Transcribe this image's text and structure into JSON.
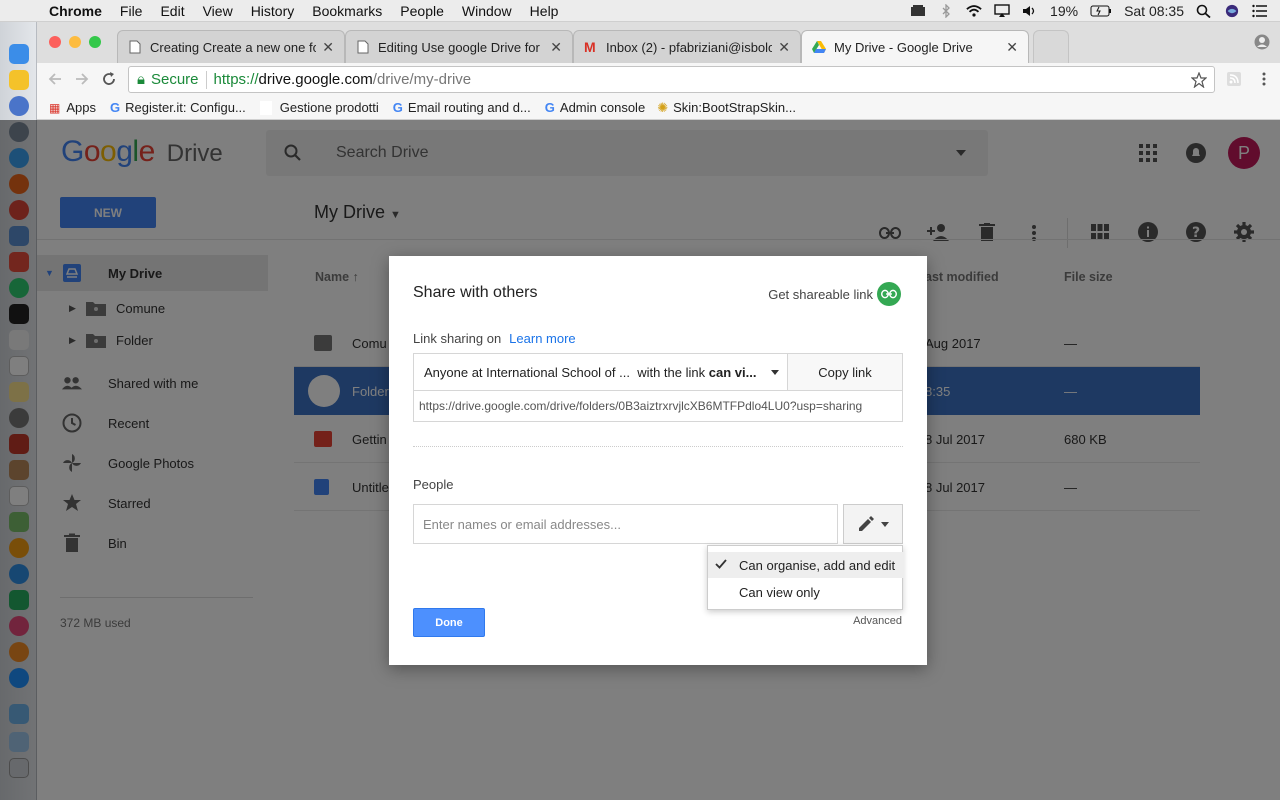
{
  "menubar": {
    "app": "Chrome",
    "items": [
      "File",
      "Edit",
      "View",
      "History",
      "Bookmarks",
      "People",
      "Window",
      "Help"
    ],
    "battery": "19%",
    "clock": "Sat 08:35"
  },
  "tabs": [
    {
      "title": "Creating Create a new one fold"
    },
    {
      "title": "Editing Use google Drive for br"
    },
    {
      "title": "Inbox (2) - pfabriziani@isbolog"
    },
    {
      "title": "My Drive - Google Drive"
    }
  ],
  "omnibox": {
    "secure": "Secure",
    "scheme": "https://",
    "host": "drive.google.com",
    "path": "/drive/my-drive"
  },
  "bookmarks": [
    "Apps",
    "Register.it: Configu...",
    "Gestione prodotti",
    "Email routing and d...",
    "Admin console",
    "Skin:BootStrapSkin..."
  ],
  "drive": {
    "logo_google": "Google",
    "logo_drive": "Drive",
    "search_placeholder": "Search Drive",
    "new_button": "NEW",
    "breadcrumb": "My Drive",
    "avatar_letter": "P",
    "nav": {
      "my_drive": "My Drive",
      "folder_comune": "Comune",
      "folder_folder": "Folder",
      "shared": "Shared with me",
      "recent": "Recent",
      "photos": "Google Photos",
      "starred": "Starred",
      "bin": "Bin"
    },
    "storage": "372 MB used",
    "columns": {
      "name": "Name",
      "last_modified": "ast modified",
      "file_size": "File size"
    },
    "rows": [
      {
        "name": "Comu",
        "modified": "Aug 2017",
        "size": "—"
      },
      {
        "name": "Folder",
        "modified": "8:35",
        "size": "—"
      },
      {
        "name": "Gettin",
        "modified": "8 Jul 2017",
        "size": "680 KB"
      },
      {
        "name": "Untitle",
        "modified": "8 Jul 2017",
        "size": "—"
      }
    ]
  },
  "dialog": {
    "title": "Share with others",
    "get_link": "Get shareable link",
    "link_sharing": "Link sharing on",
    "learn_more": "Learn more",
    "share_scope": "Anyone at International School of ...  with the link",
    "share_scope_bold": "can vi...",
    "copy_link": "Copy link",
    "url": "https://drive.google.com/drive/folders/0B3aiztrxrvjlcXB6MTFPdlo4LU0?usp=sharing",
    "people_label": "People",
    "people_placeholder": "Enter names or email addresses...",
    "perm_options": [
      "Can organise, add and edit",
      "Can view only"
    ],
    "done": "Done",
    "advanced": "Advanced"
  }
}
